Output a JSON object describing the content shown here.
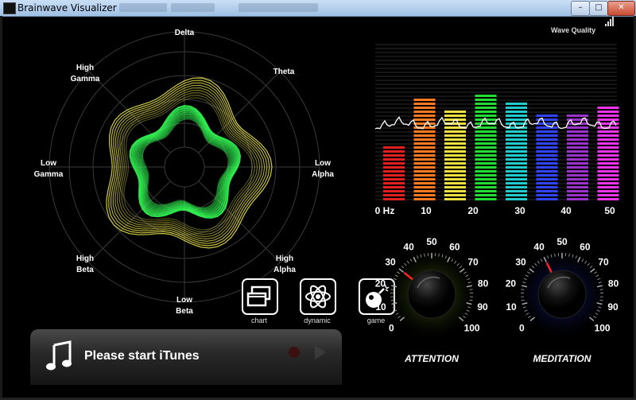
{
  "window": {
    "title": "Brainwave Visualizer",
    "controls": {
      "minimize": "–",
      "maximize": "□",
      "close": "✕"
    }
  },
  "radar": {
    "labels": {
      "delta": "Delta",
      "theta_label": "Theta",
      "low_alpha": [
        "Low",
        "Alpha"
      ],
      "high_alpha": [
        "High",
        "Alpha"
      ],
      "low_beta": [
        "Low",
        "Beta"
      ],
      "high_beta": [
        "High",
        "Beta"
      ],
      "low_gamma": [
        "Low",
        "Gamma"
      ],
      "high_gamma": [
        "High",
        "Gamma"
      ]
    },
    "colors": {
      "outer": "#e6e04a",
      "inner": "#33ff55"
    }
  },
  "spectrum": {
    "wave_quality_label": "Wave Quality",
    "signal_bars": 4,
    "x_ticks": [
      "0 Hz",
      "10",
      "20",
      "30",
      "40",
      "50"
    ],
    "bars": [
      {
        "color": "#e02020",
        "level": 0.4
      },
      {
        "color": "#ff7a20",
        "level": 0.72
      },
      {
        "color": "#f0e040",
        "level": 0.65
      },
      {
        "color": "#22dd33",
        "level": 0.76
      },
      {
        "color": "#20cccc",
        "level": 0.7
      },
      {
        "color": "#3344ff",
        "level": 0.62
      },
      {
        "color": "#9933cc",
        "level": 0.62
      },
      {
        "color": "#ee33ee",
        "level": 0.68
      }
    ]
  },
  "modes": [
    {
      "label": "chart",
      "icon": "chart-windows-icon"
    },
    {
      "label": "dynamic",
      "icon": "atom-icon"
    },
    {
      "label": "game",
      "icon": "bomb-icon"
    }
  ],
  "itunes": {
    "message": "Please start iTunes"
  },
  "gauges": [
    {
      "label": "ATTENTION",
      "value": 30,
      "ticks": [
        "0",
        "10",
        "20",
        "30",
        "40",
        "50",
        "60",
        "70",
        "80",
        "90",
        "100"
      ],
      "glow": "#88cc33"
    },
    {
      "label": "MEDITATION",
      "value": 40,
      "ticks": [
        "0",
        "10",
        "20",
        "30",
        "40",
        "50",
        "60",
        "70",
        "80",
        "90",
        "100"
      ],
      "glow": "#3344ff"
    }
  ]
}
